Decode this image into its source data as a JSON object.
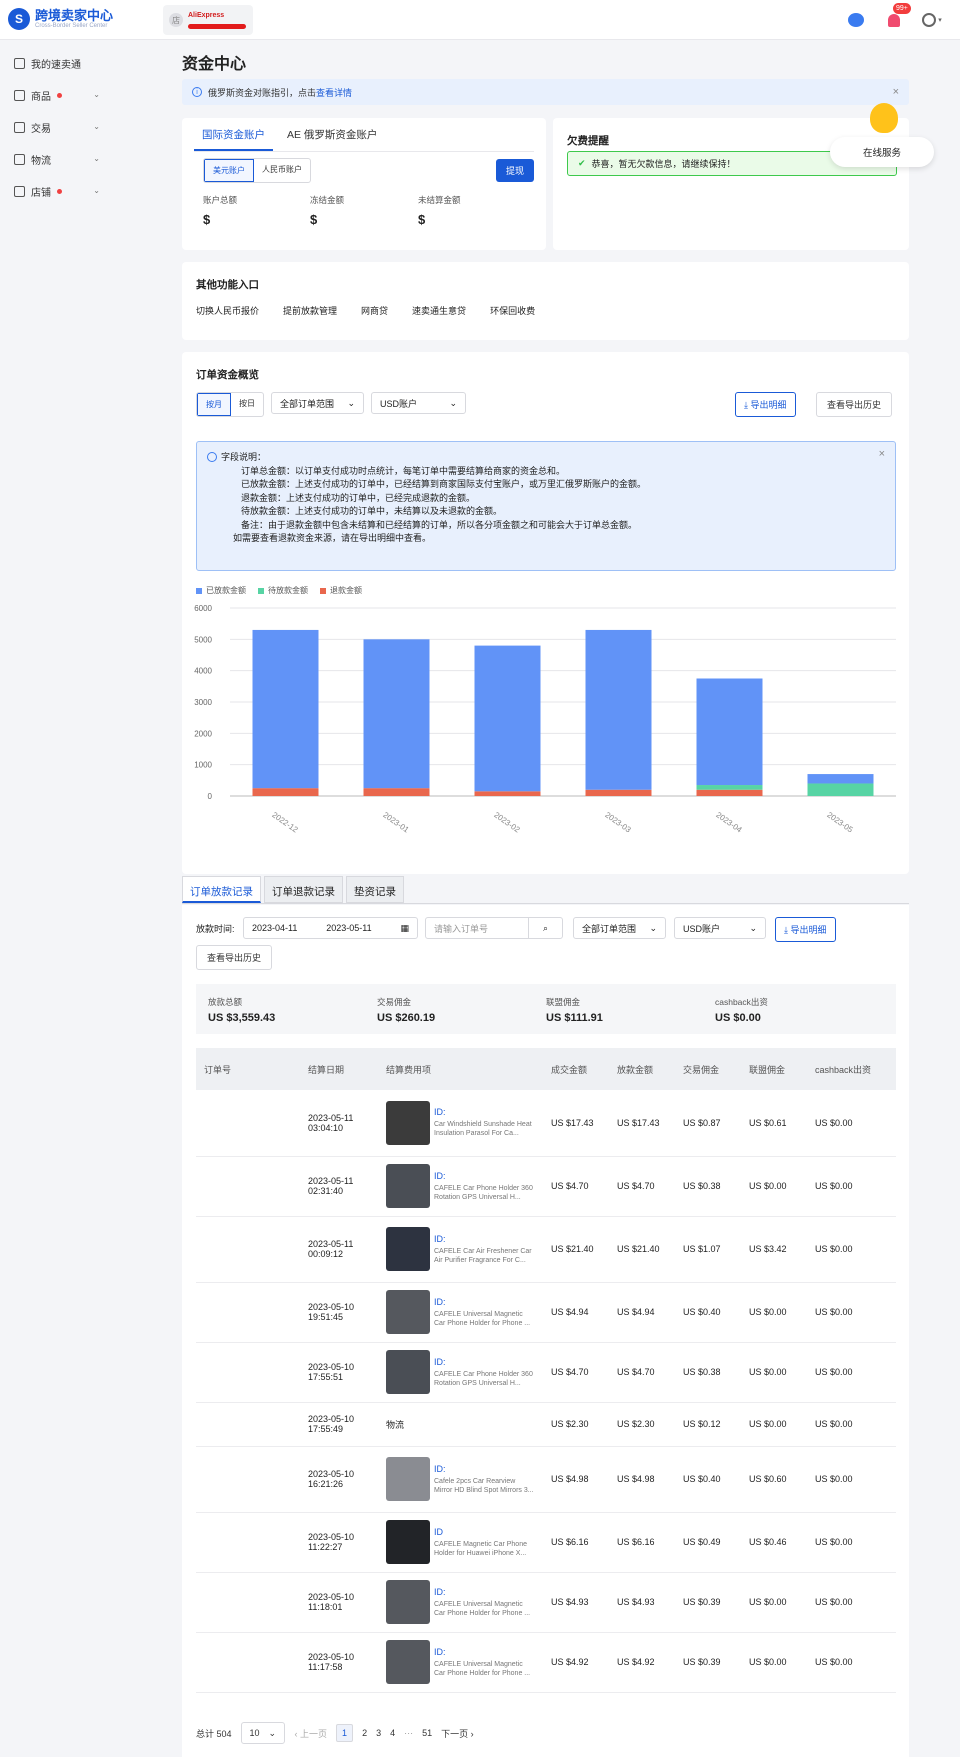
{
  "topbar": {
    "logo_title": "跨境卖家中心",
    "logo_sub": "Cross-Border Seller Center",
    "store_name": "AliExpress",
    "notification_count": "99+",
    "chat_icon": "chat-icon",
    "bell_icon": "bell-icon",
    "user_icon": "user-icon"
  },
  "sidebar": {
    "items": [
      {
        "label": "我的速卖通",
        "icon": "home-icon",
        "dot": false,
        "caret": false
      },
      {
        "label": "商品",
        "icon": "product-icon",
        "dot": true,
        "caret": true
      },
      {
        "label": "交易",
        "icon": "trade-icon",
        "dot": false,
        "caret": true
      },
      {
        "label": "物流",
        "icon": "logistics-icon",
        "dot": false,
        "caret": true
      },
      {
        "label": "店铺",
        "icon": "store-icon",
        "dot": true,
        "caret": true
      }
    ]
  },
  "page": {
    "title": "资金中心"
  },
  "notice": {
    "text": "俄罗斯资金对账指引，点击",
    "link": "查看详情"
  },
  "account": {
    "tabs": [
      "国际资金账户",
      "AE 俄罗斯资金账户"
    ],
    "currency_tabs": [
      "美元账户",
      "人民币账户"
    ],
    "withdraw_label": "提现",
    "balances": [
      {
        "label": "账户总额",
        "value": "$"
      },
      {
        "label": "冻结金额",
        "value": "$"
      },
      {
        "label": "未结算金额",
        "value": "$"
      }
    ]
  },
  "arrears": {
    "title": "欠费提醒",
    "message": "恭喜，暂无欠款信息，请继续保持！"
  },
  "service": {
    "label": "在线服务"
  },
  "other_functions": {
    "title": "其他功能入口",
    "links": [
      "切换人民币报价",
      "提前放款管理",
      "网商贷",
      "速卖通生意贷",
      "环保回收费"
    ]
  },
  "overview": {
    "title": "订单资金概览",
    "period_tabs": [
      "按月",
      "按日"
    ],
    "order_scope": "全部订单范围",
    "account_select": "USD账户",
    "export_detail": "导出明细",
    "export_history": "查看导出历史",
    "explain_lines": [
      "字段说明：",
      "订单总金额：以订单支付成功时点统计，每笔订单中需要结算给商家的资金总和。",
      "已放款金额：上述支付成功的订单中，已经结算到商家国际支付宝账户，或万里汇俄罗斯账户的金额。",
      "退款金额：上述支付成功的订单中，已经完成退款的金额。",
      "待放款金额：上述支付成功的订单中，未结算以及未退款的金额。",
      "备注：由于退款金额中包含未结算和已经结算的订单，所以各分项金额之和可能会大于订单总金额。",
      "如需要查看退款资金来源，请在导出明细中查看。"
    ]
  },
  "chart_data": {
    "type": "bar",
    "stacked": true,
    "categories": [
      "2022-12",
      "2023-01",
      "2023-02",
      "2023-03",
      "2023-04",
      "2023-05"
    ],
    "series": [
      {
        "name": "已放款金额",
        "color": "#6193f7",
        "values": [
          5050,
          4750,
          4650,
          5100,
          3400,
          300
        ]
      },
      {
        "name": "待放款金额",
        "color": "#57d4a4",
        "values": [
          0,
          0,
          0,
          0,
          150,
          400
        ]
      },
      {
        "name": "退款金额",
        "color": "#e9674d",
        "values": [
          250,
          250,
          150,
          200,
          200,
          0
        ]
      }
    ],
    "ylim": [
      0,
      6000
    ],
    "yticks": [
      "0",
      "1000",
      "2000",
      "3000",
      "4000",
      "5000",
      "6000"
    ],
    "legend": "top-left",
    "grid": true
  },
  "records": {
    "tabs": [
      "订单放款记录",
      "订单退款记录",
      "垫资记录"
    ],
    "date_label": "放款时间:",
    "date_start": "2023-04-11",
    "date_end": "2023-05-11",
    "order_placeholder": "请输入订单号",
    "order_scope": "全部订单范围",
    "account_select": "USD账户",
    "export_detail": "导出明细",
    "export_history": "查看导出历史",
    "summary": [
      {
        "label": "放款总额",
        "value": "US $3,559.43"
      },
      {
        "label": "交易佣金",
        "value": "US $260.19"
      },
      {
        "label": "联盟佣金",
        "value": "US $111.91"
      },
      {
        "label": "cashback出资",
        "value": "US $0.00"
      }
    ],
    "columns": [
      "订单号",
      "结算日期",
      "结算费用项",
      "成交金额",
      "放款金额",
      "交易佣金",
      "联盟佣金",
      "cashback出资"
    ],
    "rows": [
      {
        "date": "2023-05-11",
        "time": "03:04:10",
        "pid": "ID:",
        "desc": "Car Windshield Sunshade Heat Insulation Parasol For Ca...",
        "thumb": "#3b3b3b",
        "deal": "US $17.43",
        "pay": "US $17.43",
        "comm": "US $0.87",
        "aff": "US $0.61",
        "cb": "US $0.00"
      },
      {
        "date": "2023-05-11",
        "time": "02:31:40",
        "pid": "ID:",
        "desc": "CAFELE Car Phone Holder 360 Rotation GPS Universal H...",
        "thumb": "#4a4e55",
        "deal": "US $4.70",
        "pay": "US $4.70",
        "comm": "US $0.38",
        "aff": "US $0.00",
        "cb": "US $0.00"
      },
      {
        "date": "2023-05-11",
        "time": "00:09:12",
        "pid": "ID:",
        "desc": "CAFELE Car Air Freshener Car Air Purifier Fragrance For C...",
        "thumb": "#2d3340",
        "deal": "US $21.40",
        "pay": "US $21.40",
        "comm": "US $1.07",
        "aff": "US $3.42",
        "cb": "US $0.00"
      },
      {
        "date": "2023-05-10",
        "time": "19:51:45",
        "pid": "ID:",
        "desc": "CAFELE Universal Magnetic Car Phone Holder for Phone ...",
        "thumb": "#55585e",
        "deal": "US $4.94",
        "pay": "US $4.94",
        "comm": "US $0.40",
        "aff": "US $0.00",
        "cb": "US $0.00"
      },
      {
        "date": "2023-05-10",
        "time": "17:55:51",
        "pid": "ID:",
        "desc": "CAFELE Car Phone Holder 360 Rotation GPS Universal H...",
        "thumb": "#4a4e55",
        "deal": "US $4.70",
        "pay": "US $4.70",
        "comm": "US $0.38",
        "aff": "US $0.00",
        "cb": "US $0.00"
      },
      {
        "date": "2023-05-10",
        "time": "17:55:49",
        "pid": "",
        "desc": "物流",
        "thumb": "",
        "deal": "US $2.30",
        "pay": "US $2.30",
        "comm": "US $0.12",
        "aff": "US $0.00",
        "cb": "US $0.00"
      },
      {
        "date": "2023-05-10",
        "time": "16:21:26",
        "pid": "ID:",
        "desc": "Cafele 2pcs Car Rearview Mirror HD Blind Spot Mirrors 3...",
        "thumb": "#8a8c92",
        "deal": "US $4.98",
        "pay": "US $4.98",
        "comm": "US $0.40",
        "aff": "US $0.60",
        "cb": "US $0.00"
      },
      {
        "date": "2023-05-10",
        "time": "11:22:27",
        "pid": "ID",
        "desc": "CAFELE Magnetic Car Phone Holder for Huawei iPhone X...",
        "thumb": "#222428",
        "deal": "US $6.16",
        "pay": "US $6.16",
        "comm": "US $0.49",
        "aff": "US $0.46",
        "cb": "US $0.00"
      },
      {
        "date": "2023-05-10",
        "time": "11:18:01",
        "pid": "ID:",
        "desc": "CAFELE Universal Magnetic Car Phone Holder for Phone ...",
        "thumb": "#55585e",
        "deal": "US $4.93",
        "pay": "US $4.93",
        "comm": "US $0.39",
        "aff": "US $0.00",
        "cb": "US $0.00"
      },
      {
        "date": "2023-05-10",
        "time": "11:17:58",
        "pid": "ID:",
        "desc": "CAFELE Universal Magnetic Car Phone Holder for Phone ...",
        "thumb": "#55585e",
        "deal": "US $4.92",
        "pay": "US $4.92",
        "comm": "US $0.39",
        "aff": "US $0.00",
        "cb": "US $0.00"
      }
    ],
    "pager": {
      "total": "总计 504",
      "page_size": "10",
      "prev": "上一页",
      "next": "下一页",
      "pages": [
        "1",
        "2",
        "3",
        "4",
        "···",
        "51"
      ]
    }
  }
}
